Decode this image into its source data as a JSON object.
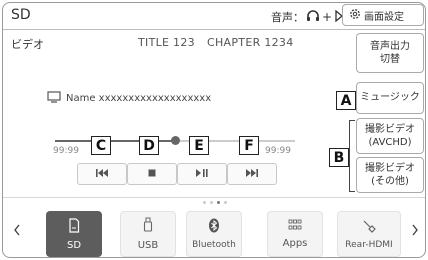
{
  "header": {
    "source": "SD",
    "audio_label": "音声：",
    "display_settings": "画面設定"
  },
  "info": {
    "category": "ビデオ",
    "title": "TITLE 123",
    "chapter": "CHAPTER 1234",
    "name": "Name xxxxxxxxxxxxxxxxxxx"
  },
  "side": {
    "audio_output_line1": "音声出力",
    "audio_output_line2": "切替",
    "music": "ミュージック",
    "camera_avchd_line1": "撮影ビデオ",
    "camera_avchd_line2": "(AVCHD)",
    "camera_other_line1": "撮影ビデオ",
    "camera_other_line2": "(その他)"
  },
  "progress": {
    "start": "99:99",
    "end": "99:99",
    "fraction": 0.5
  },
  "callouts": {
    "a": "A",
    "b": "B",
    "c": "C",
    "d": "D",
    "e": "E",
    "f": "F"
  },
  "sources": [
    {
      "label": "SD",
      "icon": "sd-card-icon",
      "active": true
    },
    {
      "label": "USB",
      "icon": "usb-icon",
      "active": false
    },
    {
      "label": "Bluetooth",
      "icon": "bluetooth-icon",
      "active": false
    },
    {
      "label": "Apps",
      "icon": "apps-grid-icon",
      "active": false
    },
    {
      "label": "Rear-HDMI",
      "icon": "hdmi-cable-icon",
      "active": false
    }
  ],
  "colors": {
    "active_tile": "#5d5d5d",
    "border": "#9a9a9a"
  }
}
